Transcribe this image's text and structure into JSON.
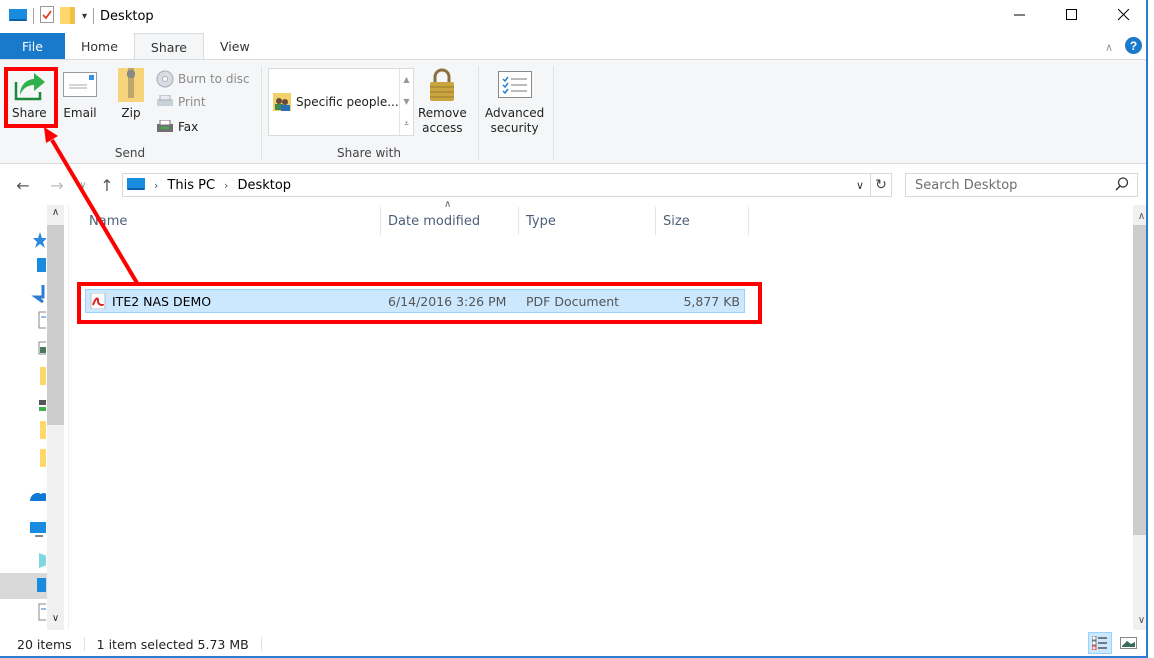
{
  "window": {
    "title": "Desktop",
    "controls": [
      "minimize",
      "maximize",
      "close"
    ],
    "quick_access_icons": [
      "computer-icon",
      "properties-icon",
      "new-folder-icon",
      "customize-qat-icon"
    ]
  },
  "ribbon_tabs": [
    {
      "label": "File",
      "active": false
    },
    {
      "label": "Home",
      "active": false
    },
    {
      "label": "Share",
      "active": true
    },
    {
      "label": "View",
      "active": false
    }
  ],
  "ribbon": {
    "send_group": {
      "label": "Send",
      "share": "Share",
      "email": "Email",
      "zip": "Zip",
      "burn": "Burn to disc",
      "print": "Print",
      "fax": "Fax"
    },
    "share_with_group": {
      "label": "Share with",
      "gallery_item": "Specific people...",
      "remove_access_line1": "Remove",
      "remove_access_line2": "access"
    },
    "advanced": {
      "line1": "Advanced",
      "line2": "security"
    }
  },
  "address_bar": {
    "breadcrumbs": [
      "This PC",
      "Desktop"
    ],
    "search_placeholder": "Search Desktop"
  },
  "columns": {
    "name": "Name",
    "date": "Date modified",
    "type": "Type",
    "size": "Size"
  },
  "files": [
    {
      "name": "ITE2 NAS DEMO",
      "date_modified": "6/14/2016 3:26 PM",
      "type": "PDF Document",
      "size": "5,877 KB",
      "selected": true
    }
  ],
  "status": {
    "item_count": "20 items",
    "selection": "1 item selected  5.73 MB"
  },
  "colors": {
    "file_tab": "#1979ca",
    "selection": "#cce8ff",
    "annotation": "#ff0000"
  }
}
